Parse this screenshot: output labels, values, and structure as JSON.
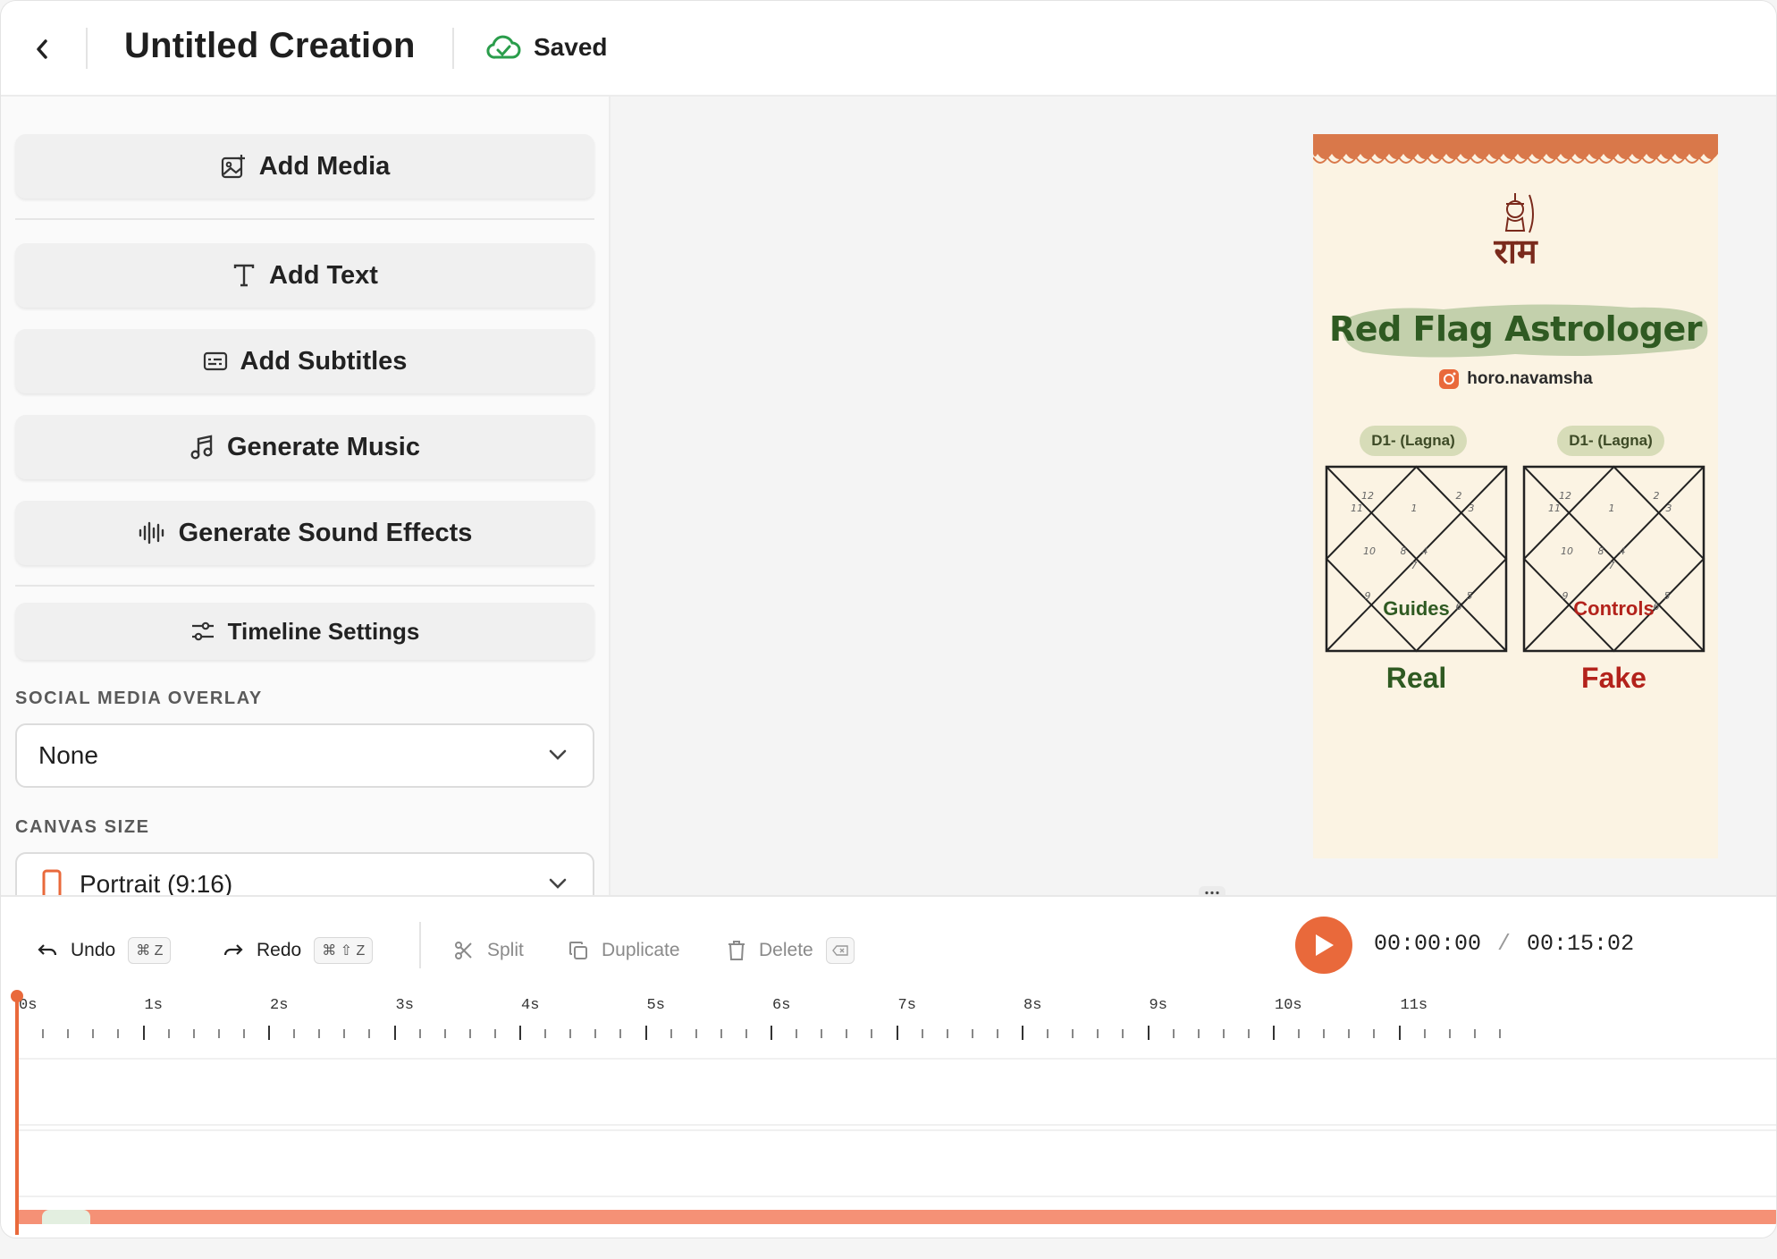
{
  "header": {
    "title": "Untitled Creation",
    "status": "Saved"
  },
  "sidebar": {
    "buttons": {
      "add_media": "Add Media",
      "add_text": "Add Text",
      "add_subtitles": "Add Subtitles",
      "generate_music": "Generate Music",
      "generate_sound_effects": "Generate Sound Effects",
      "timeline_settings": "Timeline Settings"
    },
    "social_media_overlay": {
      "label": "SOCIAL MEDIA OVERLAY",
      "value": "None"
    },
    "canvas_size": {
      "label": "CANVAS SIZE",
      "value": "Portrait (9:16)"
    }
  },
  "preview": {
    "logo_text": "राम",
    "title": "Red Flag Astrologer",
    "handle": "horo.navamsha",
    "charts": [
      {
        "label": "D1- (Lagna)",
        "center_word": "Guides",
        "caption": "Real",
        "color": "#2f5a22"
      },
      {
        "label": "D1- (Lagna)",
        "center_word": "Controls",
        "caption": "Fake",
        "color": "#b3221b"
      }
    ],
    "house_numbers": [
      "12",
      "1",
      "2",
      "11",
      "3",
      "10",
      "8",
      "4",
      "7",
      "9",
      "5",
      "6"
    ]
  },
  "toolbar": {
    "undo": "Undo",
    "undo_shortcut": "⌘ Z",
    "redo": "Redo",
    "redo_shortcut": "⌘ ⇧ Z",
    "split": "Split",
    "duplicate": "Duplicate",
    "delete": "Delete",
    "current_time": "00:00:00",
    "separator": "/",
    "total_time": "00:15:02"
  },
  "timeline": {
    "ticks": [
      "0s",
      "1s",
      "2s",
      "3s",
      "4s",
      "5s",
      "6s",
      "7s",
      "8s",
      "9s",
      "10s",
      "11s"
    ]
  },
  "colors": {
    "accent": "#e9693b",
    "saved_green": "#2a9d4b"
  }
}
